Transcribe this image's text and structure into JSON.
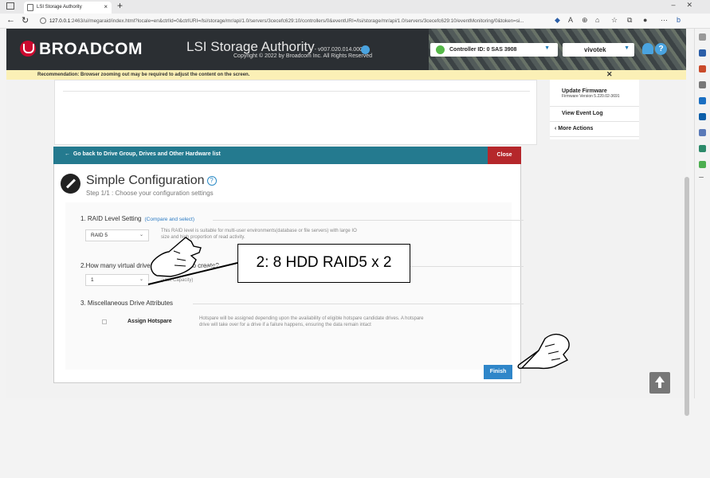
{
  "browser": {
    "tab_title": "LSI Storage Authority",
    "url_host": "127.0.0.1",
    "url_rest": ":2463/ui/megaraid/index.html?locale=en&ctrlId=0&ctrlURI=/lsi/storage/mr/api/1.0/servers/3cecefc629:10/controllers/0&eventURI=/lsi/storage/mr/api/1.0/servers/3cecefc629:10/eventMonitoring/0&token=si..."
  },
  "header": {
    "brand": "BROADCOM",
    "app_title": "LSI Storage Authority",
    "version": "- v007.020.014.000",
    "copyright": "Copyright © 2022 by Broadcom Inc. All Rights Reserved",
    "controller": "Controller ID: 0 SAS 3908",
    "user": "vivotek"
  },
  "recommendation": {
    "text": "Recommendation: Browser zooming out may be required to adjust the content on the screen.",
    "close": "✕"
  },
  "actions": {
    "update_firmware": "Update Firmware",
    "firmware_version": "Firmware Version 5.220.02-3691",
    "view_event_log": "View Event Log",
    "more_actions": "More Actions"
  },
  "modal": {
    "back_link": "Go back to Drive Group, Drives and Other Hardware list",
    "close": "Close",
    "title": "Simple Configuration",
    "step": "Step 1/1 : Choose your configuration settings",
    "raid_heading": "1. RAID Level Setting",
    "compare_link": "(Compare and select)",
    "raid_value": "RAID 5",
    "raid_desc": "This RAID level is suitable for multi-user environments(database or file servers) with large IO size and high proportion of read activity.",
    "vd_heading": "2.How many virtual drives do you wish to create?",
    "vd_value": "1",
    "vd_desc": "(Max Capacity)",
    "misc_heading": "3. Miscellaneous Drive Attributes",
    "hotspare_label": "Assign Hotspare",
    "hotspare_desc": "Hotspare will be assigned depending upon the availability of eligible hotspare candidate drives. A hotspare drive will take over for a drive if a failure happens, ensuring the data remain intact",
    "finish": "Finish"
  },
  "annotation": {
    "callout": "2: 8 HDD RAID5 x 2"
  }
}
